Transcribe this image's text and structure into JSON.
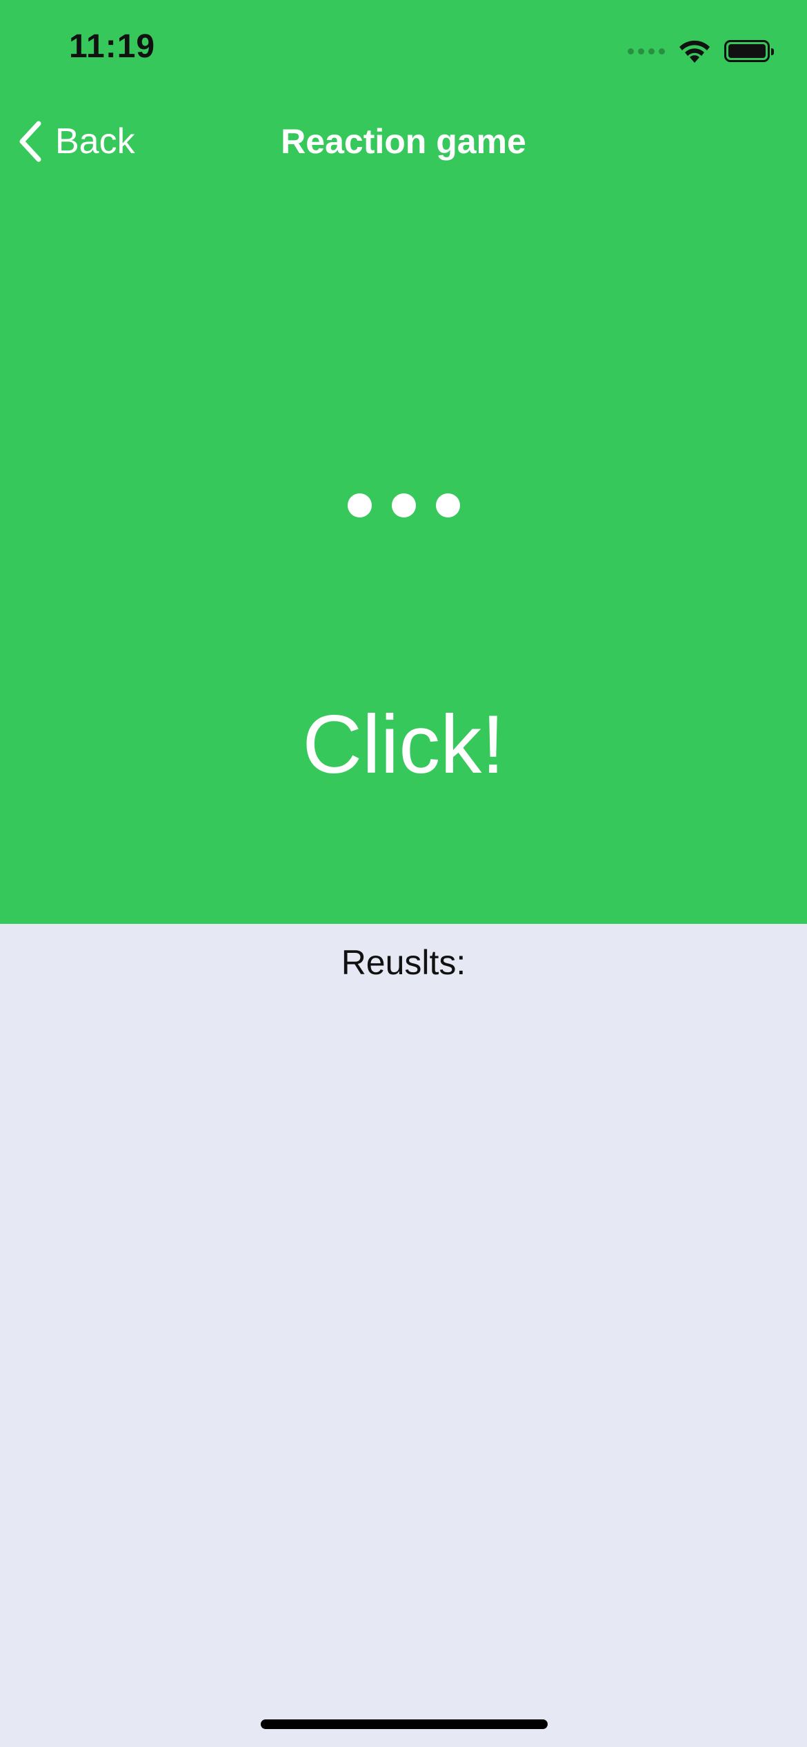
{
  "status_bar": {
    "time": "11:19",
    "signal_icon": "cellular-signal-dots",
    "wifi_icon": "wifi-icon",
    "battery_icon": "battery-full-icon",
    "battery_level": 1.0
  },
  "nav": {
    "back_label": "Back",
    "back_icon": "chevron-left-icon",
    "title": "Reaction game"
  },
  "game": {
    "background_color": "#37C85C",
    "waiting_indicator": "three-dots",
    "prompt": "Click!"
  },
  "results": {
    "label": "Reuslts:",
    "background_color": "#E6E9F4"
  }
}
